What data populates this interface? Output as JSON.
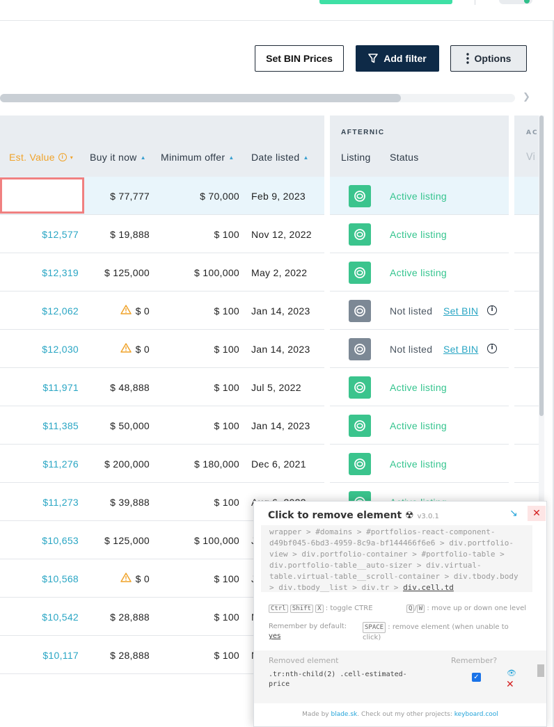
{
  "toolbar": {
    "set_bin_label": "Set BIN Prices",
    "add_filter_label": "Add filter",
    "options_label": "Options"
  },
  "table": {
    "group_afternic": "AFTERNIC",
    "group_next_partial": "AC",
    "next_col_partial": "Vi",
    "columns": {
      "est_value": "Est. Value",
      "buy_it_now": "Buy it now",
      "minimum_offer": "Minimum offer",
      "date_listed": "Date listed",
      "listing": "Listing",
      "status": "Status"
    },
    "set_bin_link": "Set BIN",
    "rows": [
      {
        "est": "",
        "buy": "$ 77,777",
        "min": "$ 70,000",
        "date": "Feb 9, 2023",
        "status": "Active listing",
        "listed": true,
        "warn": false
      },
      {
        "est": "$12,577",
        "buy": "$ 19,888",
        "min": "$ 100",
        "date": "Nov 12, 2022",
        "status": "Active listing",
        "listed": true,
        "warn": false
      },
      {
        "est": "$12,319",
        "buy": "$ 125,000",
        "min": "$ 100,000",
        "date": "May 2, 2022",
        "status": "Active listing",
        "listed": true,
        "warn": false
      },
      {
        "est": "$12,062",
        "buy": "$ 0",
        "min": "$ 100",
        "date": "Jan 14, 2023",
        "status": "Not listed",
        "listed": false,
        "warn": true
      },
      {
        "est": "$12,030",
        "buy": "$ 0",
        "min": "$ 100",
        "date": "Jan 14, 2023",
        "status": "Not listed",
        "listed": false,
        "warn": true
      },
      {
        "est": "$11,971",
        "buy": "$ 48,888",
        "min": "$ 100",
        "date": "Jul 5, 2022",
        "status": "Active listing",
        "listed": true,
        "warn": false
      },
      {
        "est": "$11,385",
        "buy": "$ 50,000",
        "min": "$ 100",
        "date": "Jan 14, 2023",
        "status": "Active listing",
        "listed": true,
        "warn": false
      },
      {
        "est": "$11,276",
        "buy": "$ 200,000",
        "min": "$ 180,000",
        "date": "Dec 6, 2021",
        "status": "Active listing",
        "listed": true,
        "warn": false
      },
      {
        "est": "$11,273",
        "buy": "$ 39,888",
        "min": "$ 100",
        "date": "Aug 6, 2022",
        "status": "Active listing",
        "listed": true,
        "warn": false
      },
      {
        "est": "$10,653",
        "buy": "$ 125,000",
        "min": "$ 100,000",
        "date": "J",
        "status": "",
        "listed": true,
        "warn": false
      },
      {
        "est": "$10,568",
        "buy": "$ 0",
        "min": "$ 100",
        "date": "J",
        "status": "",
        "listed": true,
        "warn": true
      },
      {
        "est": "$10,542",
        "buy": "$ 28,888",
        "min": "$ 100",
        "date": "N",
        "status": "",
        "listed": true,
        "warn": false
      },
      {
        "est": "$10,117",
        "buy": "$ 28,888",
        "min": "$ 100",
        "date": "N",
        "status": "",
        "listed": true,
        "warn": false
      }
    ]
  },
  "ctre": {
    "title": "Click to remove element",
    "version": "v3.0.1",
    "path_lines": [
      "wrapper > #domains > #portfolios-react-component-",
      "d49bf045-6bd3-4959-8c9a-bf144466f6e6 > div.portfolio-",
      "view > div.portfolio-container > #portfolio-table >",
      "div.portfolio-table__auto-sizer > div.virtual-",
      "table.virtual-table__scroll-container > div.tbody.body",
      "> div.tbody__list > div.tr > "
    ],
    "path_current": "div.cell.td",
    "key_ctrl": "Ctrl",
    "key_shift": "Shift",
    "key_x": "X",
    "toggle_text": ": toggle CTRE",
    "key_q": "Q",
    "key_w": "W",
    "move_text": ": move up or down one level",
    "remember_text": "Remember by default:",
    "remember_value": "yes",
    "key_space": "SPACE",
    "space_text_1": ": remove element (when unable to",
    "space_text_2": "click)",
    "removed_header": "Removed element",
    "remember_header": "Remember?",
    "removed_item_1": ".tr:nth-child(2) .cell-estimated-",
    "removed_item_2": "price",
    "footer_prefix": "Made by",
    "footer_author": "blade.sk",
    "footer_mid": ". Check out my other projects:",
    "footer_link": "keyboard.cool"
  }
}
